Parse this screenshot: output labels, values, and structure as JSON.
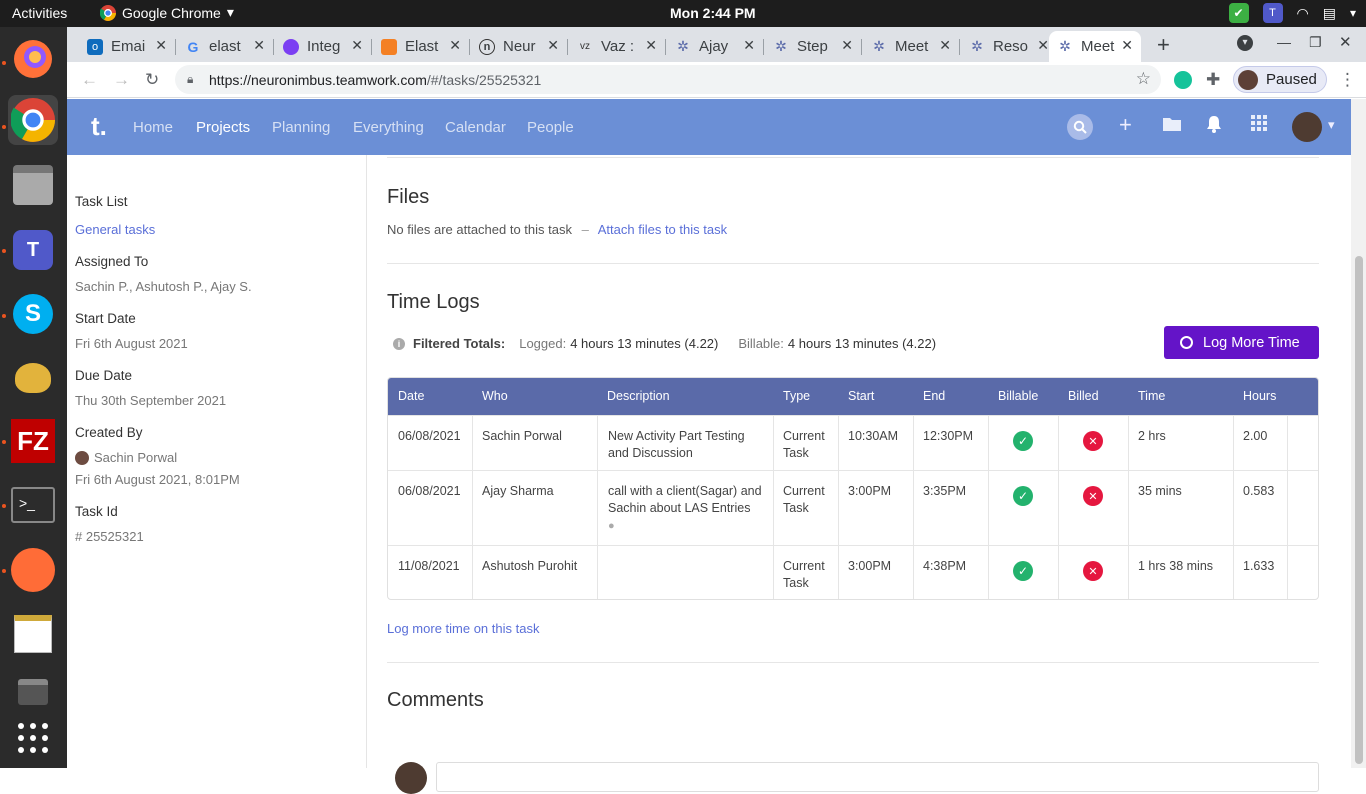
{
  "os": {
    "activities": "Activities",
    "app_name": "Google Chrome",
    "clock": "Mon  2:44 PM"
  },
  "browser": {
    "tabs": [
      {
        "label": "Emai"
      },
      {
        "label": "elast"
      },
      {
        "label": "Integ"
      },
      {
        "label": "Elast"
      },
      {
        "label": "Neur"
      },
      {
        "label": "Vaz :"
      },
      {
        "label": "Ajay"
      },
      {
        "label": "Step"
      },
      {
        "label": "Meet"
      },
      {
        "label": "Reso"
      },
      {
        "label": "Meet"
      }
    ],
    "url_host": "https://neuronimbus.teamwork.com",
    "url_path": "/#/tasks/25525321",
    "profile_label": "Paused"
  },
  "app": {
    "logo": "t.",
    "nav": [
      "Home",
      "Projects",
      "Planning",
      "Everything",
      "Calendar",
      "People"
    ]
  },
  "sidebar": {
    "task_list_label": "Task List",
    "task_list_value": "General tasks",
    "assigned_label": "Assigned To",
    "assigned_value": "Sachin P., Ashutosh P., Ajay S.",
    "start_label": "Start Date",
    "start_value": "Fri 6th August 2021",
    "due_label": "Due Date",
    "due_value": "Thu 30th September 2021",
    "created_label": "Created By",
    "created_by": "Sachin Porwal",
    "created_at": "Fri 6th August 2021, 8:01PM",
    "taskid_label": "Task Id",
    "taskid_value": "# 25525321"
  },
  "files": {
    "title": "Files",
    "empty_text": "No files are attached to this task",
    "sep": "–",
    "attach_link": "Attach files to this task"
  },
  "timelogs": {
    "title": "Time Logs",
    "totals_label": "Filtered Totals:",
    "logged_label": "Logged:",
    "logged_value": "4 hours 13 minutes (4.22)",
    "billable_label": "Billable:",
    "billable_value": "4 hours 13 minutes (4.22)",
    "log_button": "Log More Time",
    "columns": [
      "Date",
      "Who",
      "Description",
      "Type",
      "Start",
      "End",
      "Billable",
      "Billed",
      "Time",
      "Hours"
    ],
    "rows": [
      {
        "date": "06/08/2021",
        "who": "Sachin Porwal",
        "desc1": "New Activity Part Testing",
        "desc2": "and Discussion",
        "type1": "Current",
        "type2": "Task",
        "start": "10:30AM",
        "end": "12:30PM",
        "time": "2 hrs",
        "hours": "2.00"
      },
      {
        "date": "06/08/2021",
        "who": "Ajay Sharma",
        "desc1": "call with a client(Sagar) and",
        "desc2": "Sachin about LAS Entries",
        "type1": "Current",
        "type2": "Task",
        "start": "3:00PM",
        "end": "3:35PM",
        "time": "35 mins",
        "hours": "0.583"
      },
      {
        "date": "11/08/2021",
        "who": "Ashutosh Purohit",
        "desc1": "",
        "desc2": "",
        "type1": "Current",
        "type2": "Task",
        "start": "3:00PM",
        "end": "4:38PM",
        "time": "1 hrs 38 mins",
        "hours": "1.633"
      }
    ],
    "log_more_link": "Log more time on this task"
  },
  "comments": {
    "title": "Comments"
  }
}
